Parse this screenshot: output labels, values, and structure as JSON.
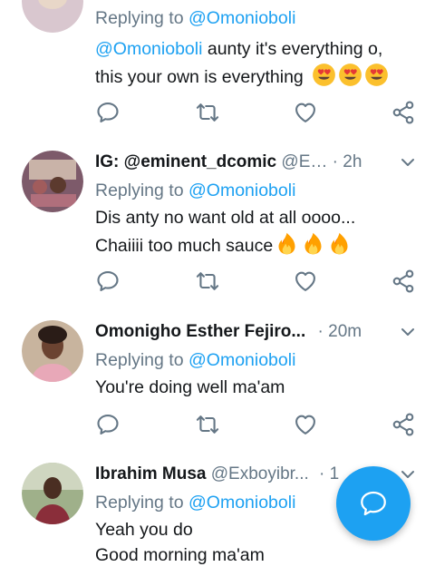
{
  "tweets": [
    {
      "reply_prefix": "Replying to",
      "reply_to": "@Omonioboli",
      "text_line1_mention": "@Omonioboli",
      "text_line1": " aunty it's everything o,",
      "text_line2": "this your own is everything",
      "emoji": "heart-eyes-emoji"
    },
    {
      "name": "IG: @eminent_dcomic",
      "handle": "@E…",
      "separator": "·",
      "time": "2h",
      "reply_prefix": "Replying to",
      "reply_to": "@Omonioboli",
      "text_line1": "Dis anty no want old at all oooo...",
      "text_line2": "Chaiiii too much sauce",
      "emoji": "fire-emoji"
    },
    {
      "name": "Omonigho Esther Fejiro...",
      "separator": "·",
      "time": "20m",
      "reply_prefix": "Replying to",
      "reply_to": "@Omonioboli",
      "text_line1": "You're doing well ma'am"
    },
    {
      "name": "Ibrahim Musa",
      "handle": "@Exboyibr...",
      "separator": "·",
      "time": "1",
      "reply_prefix": "Replying to",
      "reply_to": "@Omonioboli",
      "text_line1": "Yeah you do",
      "text_line2": "Good morning ma'am"
    }
  ],
  "icons": {
    "reply": "reply-icon",
    "retweet": "retweet-icon",
    "like": "heart-icon",
    "share": "share-icon",
    "more": "chevron-down-icon",
    "compose": "compose-icon"
  },
  "colors": {
    "accent": "#1da1f2",
    "secondary_text": "#657786",
    "icon": "#657786",
    "divider": "#e1e8ed"
  }
}
